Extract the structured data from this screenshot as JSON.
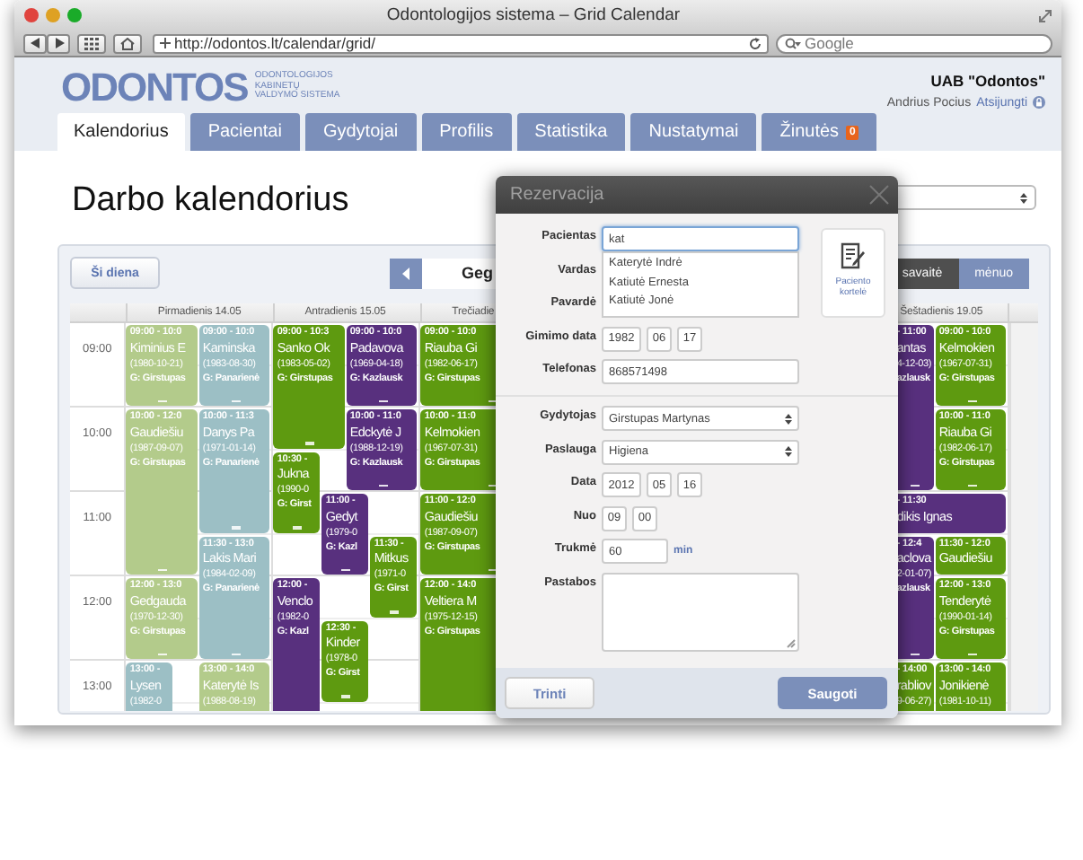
{
  "browser": {
    "title": "Odontologijos sistema – Grid Calendar",
    "url": "http://odontos.lt/calendar/grid/",
    "search_placeholder": "Google"
  },
  "header": {
    "logo": "ODONTOS",
    "logo_subtitle": [
      "ODONTOLOGIJOS",
      "KABINETŲ",
      "VALDYMO SISTEMA"
    ],
    "company": "UAB \"Odontos\"",
    "user": "Andrius Pocius",
    "logout": "Atsijungti"
  },
  "tabs": [
    {
      "label": "Kalendorius",
      "selected": true
    },
    {
      "label": "Pacientai",
      "selected": false
    },
    {
      "label": "Gydytojai",
      "selected": false
    },
    {
      "label": "Profilis",
      "selected": false
    },
    {
      "label": "Statistika",
      "selected": false
    },
    {
      "label": "Nustatymai",
      "selected": false
    },
    {
      "label": "Žinutės",
      "selected": false,
      "badge": "0"
    }
  ],
  "page_title": "Darbo kalendorius",
  "toolbar": {
    "today": "Ši diena",
    "period": "Geg",
    "views": [
      {
        "label": "savaitė",
        "selected": true
      },
      {
        "label": "mėnuo",
        "selected": false
      }
    ]
  },
  "calendar": {
    "times": [
      "09:00",
      "10:00",
      "11:00",
      "12:00",
      "13:00"
    ],
    "days": [
      {
        "label": "Pirmadienis 14.05",
        "events": [
          {
            "color": "#b3cb8b",
            "time": "09:00 - 10:0",
            "patient": "Kiminius E",
            "born": "(1980-10-21)",
            "doctor": "G: Girstupas"
          },
          {
            "color": "#9cbfc5",
            "time": "09:00 - 10:0",
            "patient": "Kaminska",
            "born": "(1983-08-30)",
            "doctor": "G: Panarienė"
          },
          {
            "color": "#b3cb8b",
            "time": "10:00 - 12:0",
            "patient": "Gaudiešiu",
            "born": "(1987-09-07)",
            "doctor": "G: Girstupas"
          },
          {
            "color": "#9cbfc5",
            "time": "10:00 - 11:3",
            "patient": "Danys Pa",
            "born": "(1971-01-14)",
            "doctor": "G: Panarienė"
          },
          {
            "color": "#9cbfc5",
            "time": "11:30 - 13:0",
            "patient": "Lakis Mari",
            "born": "(1984-02-09)",
            "doctor": "G: Panarienė"
          },
          {
            "color": "#b3cb8b",
            "time": "12:00 - 13:0",
            "patient": "Gedgauda",
            "born": "(1970-12-30)",
            "doctor": "G: Girstupas"
          },
          {
            "color": "#9cbfc5",
            "time": "13:00 -",
            "patient": "Lysen",
            "born": "(1982-0"
          },
          {
            "color": "#b3cb8b",
            "time": "13:00 - 14:0",
            "patient": "Katerytė Is",
            "born": "(1988-08-19)"
          }
        ]
      },
      {
        "label": "Antradienis 15.05",
        "events": [
          {
            "color": "#5e9a10",
            "time": "09:00 - 10:3",
            "patient": "Sanko Ok",
            "born": "(1983-05-02)",
            "doctor": "G: Girstupas"
          },
          {
            "color": "#58307e",
            "time": "09:00 - 10:0",
            "patient": "Padavova",
            "born": "(1969-04-18)",
            "doctor": "G: Kazlausk"
          },
          {
            "color": "#58307e",
            "time": "10:00 - 11:0",
            "patient": "Edckytė J",
            "born": "(1988-12-19)",
            "doctor": "G: Kazlausk"
          },
          {
            "color": "#5e9a10",
            "time": "10:30 -",
            "patient": "Jukna",
            "born": "(1990-0",
            "doctor": "G: Girst"
          },
          {
            "color": "#58307e",
            "time": "11:00 -",
            "patient": "Gedyt",
            "born": "(1979-0",
            "doctor": "G: Kazl"
          },
          {
            "color": "#5e9a10",
            "time": "11:30 -",
            "patient": "Mitkus",
            "born": "(1971-0",
            "doctor": "G: Girst"
          },
          {
            "color": "#58307e",
            "time": "12:00 -",
            "patient": "Venclo",
            "born": "(1982-0",
            "doctor": "G: Kazl"
          },
          {
            "color": "#5e9a10",
            "time": "12:30 -",
            "patient": "Kinder",
            "born": "(1978-0",
            "doctor": "G: Girst"
          }
        ]
      },
      {
        "label": "Trečiadie",
        "events": [
          {
            "color": "#5e9a10",
            "time": "09:00 - 10:0",
            "patient": "Riauba Gi",
            "born": "(1982-06-17)",
            "doctor": "G: Girstupas"
          },
          {
            "color": "#5e9a10",
            "time": "10:00 - 11:0",
            "patient": "Kelmokien",
            "born": "(1967-07-31)",
            "doctor": "G: Girstupas"
          },
          {
            "color": "#5e9a10",
            "time": "11:00 - 12:0",
            "patient": "Gaudiešiu",
            "born": "(1987-09-07)",
            "doctor": "G: Girstupas"
          },
          {
            "color": "#5e9a10",
            "time": "12:00 - 14:0",
            "patient": "Veltiera M",
            "born": "(1975-12-15)",
            "doctor": "G: Girstupas"
          }
        ]
      },
      {
        "label": "Šeštadienis 19.05",
        "events": [
          {
            "color": "#58307e",
            "time": "- 11:00",
            "patient": "antas",
            "born": "4-12-03)",
            "doctor": "azlausk"
          },
          {
            "color": "#5e9a10",
            "time": "09:00 - 10:0",
            "patient": "Kelmokien",
            "born": "(1967-07-31)",
            "doctor": "G: Girstupas"
          },
          {
            "color": "#5e9a10",
            "time": "10:00 - 11:0",
            "patient": "Riauba Gi",
            "born": "(1982-06-17)",
            "doctor": "G: Girstupas"
          },
          {
            "color": "#58307e",
            "time": "- 11:30",
            "patient": "dikis Ignas"
          },
          {
            "color": "#58307e",
            "time": "- 12:4",
            "patient": "aclova",
            "born": "2-01-07)",
            "doctor": "azlausk"
          },
          {
            "color": "#5e9a10",
            "time": "11:30 - 12:0",
            "patient": "Gaudiešiu"
          },
          {
            "color": "#5e9a10",
            "time": "12:00 - 13:0",
            "patient": "Tenderytė",
            "born": "(1990-01-14)",
            "doctor": "G: Girstupas"
          },
          {
            "color": "#5e9a10",
            "time": "- 14:00",
            "patient": "rabliov",
            "born": "9-06-27)"
          },
          {
            "color": "#5e9a10",
            "time": "13:00 - 14:0",
            "patient": "Jonikienė",
            "born": "(1981-10-11)"
          }
        ]
      }
    ]
  },
  "modal": {
    "title": "Rezervacija",
    "card_button": "Paciento kortelė",
    "fields": [
      {
        "kind": "autocomplete",
        "label": "Pacientas",
        "value": "kat",
        "suggestions": [
          "Katerytė Indrė",
          "Katiutė Ernesta",
          "Katiutė Jonė"
        ]
      },
      {
        "kind": "covered",
        "label": "Vardas"
      },
      {
        "kind": "covered",
        "label": "Pavardė"
      },
      {
        "kind": "parts",
        "label": "Gimimo data",
        "parts": [
          "1982",
          "06",
          "17"
        ]
      },
      {
        "kind": "text",
        "label": "Telefonas",
        "value": "868571498"
      },
      {
        "kind": "divider"
      },
      {
        "kind": "select",
        "label": "Gydytojas",
        "value": "Girstupas Martynas"
      },
      {
        "kind": "select",
        "label": "Paslauga",
        "value": "Higiena"
      },
      {
        "kind": "parts",
        "label": "Data",
        "parts": [
          "2012",
          "05",
          "16"
        ]
      },
      {
        "kind": "parts",
        "label": "Nuo",
        "parts": [
          "09",
          "00"
        ]
      },
      {
        "kind": "duration",
        "label": "Trukmė",
        "value": "60",
        "unit": "min"
      },
      {
        "kind": "textarea",
        "label": "Pastabos"
      }
    ],
    "delete": "Trinti",
    "save": "Saugoti"
  }
}
